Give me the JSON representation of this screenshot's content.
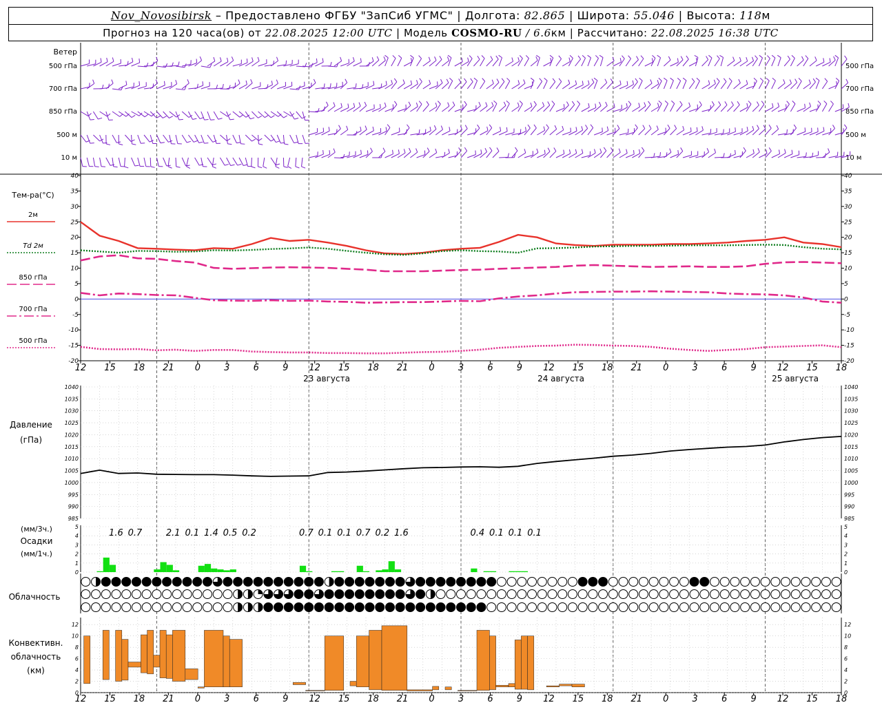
{
  "header": {
    "station": "Nov_Novosibirsk",
    "sep1": " – ",
    "provider": "Предоставлено ФГБУ \"ЗапСиб УГМС\"",
    "lon_label": "Долгота:",
    "lon_value": "82.865",
    "lat_label": "Широта:",
    "lat_value": "55.046",
    "alt_label": "Высота:",
    "alt_value": "118",
    "alt_unit": "м",
    "forecast_prefix": "Прогноз на 120 часа(ов) от",
    "forecast_time": "22.08.2025 12:00 UTC",
    "model_label": "Модель",
    "model_name": "COSMO-RU",
    "model_res": "6.6",
    "model_res_unit": "км",
    "calc_label": "Рассчитано:",
    "calc_time": "22.08.2025 16:38 UTC"
  },
  "chart_data": [
    {
      "type": "wind_barbs",
      "title": "Ветер",
      "levels": [
        "500 гПа",
        "700 гПа",
        "850 гПа",
        "500 м",
        "10 м"
      ],
      "color": "#7b20c8"
    },
    {
      "type": "line",
      "title": "Тем-ра(°С)",
      "ylim": [
        -20,
        40
      ],
      "yticks": [
        -20,
        -15,
        -10,
        -5,
        0,
        5,
        10,
        15,
        20,
        25,
        30,
        35,
        40
      ],
      "x_hours_since_start": [
        0,
        3,
        6,
        9,
        12,
        15,
        18,
        21,
        24,
        27,
        30,
        33,
        36,
        39,
        42,
        45,
        48,
        51,
        54,
        57,
        60,
        63,
        66,
        69,
        72,
        75,
        78,
        81,
        84,
        87,
        90,
        93,
        96,
        99,
        102,
        105,
        108,
        111,
        114,
        117,
        120
      ],
      "series": [
        {
          "name": "2м",
          "color": "#e8322b",
          "dash": "solid",
          "values": [
            25,
            20.5,
            18.8,
            16.5,
            16.3,
            16,
            15.8,
            16.5,
            16.3,
            17.8,
            19.8,
            18.8,
            19.2,
            18.3,
            17.2,
            15.8,
            14.8,
            14.6,
            15,
            15.8,
            16.3,
            16.6,
            18.5,
            20.8,
            20,
            18,
            17.5,
            17.2,
            17.6,
            17.6,
            17.6,
            17.8,
            17.8,
            18,
            18.3,
            18.8,
            19.2,
            20,
            18.3,
            17.8,
            16.8
          ]
        },
        {
          "name": "Td  2м",
          "color": "#0c7c1c",
          "dash": "dotted",
          "values": [
            15.8,
            15.4,
            15,
            15.6,
            15.5,
            15.3,
            15.4,
            15.8,
            15.7,
            15.9,
            16.2,
            16.4,
            16.7,
            16.3,
            15.6,
            15,
            14.5,
            14.3,
            14.8,
            15.5,
            15.8,
            15.5,
            15.4,
            15,
            16.4,
            16.5,
            16.7,
            17,
            17.1,
            17.2,
            17.2,
            17.3,
            17.4,
            17.4,
            17.4,
            17.5,
            17.6,
            17.5,
            16.8,
            16.3,
            16.1
          ]
        },
        {
          "name": "850 гПа",
          "color": "#e0288a",
          "dash": "longdash",
          "values": [
            12.5,
            13.8,
            14.2,
            13.2,
            13,
            12.3,
            11.8,
            10.1,
            9.8,
            10,
            10.2,
            10.3,
            10.2,
            10.1,
            9.8,
            9.5,
            9,
            9,
            9,
            9.2,
            9.4,
            9.5,
            9.8,
            10,
            10.2,
            10.4,
            10.8,
            11,
            10.8,
            10.6,
            10.4,
            10.5,
            10.6,
            10.4,
            10.4,
            10.6,
            11.4,
            11.9,
            12,
            11.8,
            11.6
          ]
        },
        {
          "name": "700 гПа",
          "color": "#e0288a",
          "dash": "dashdot",
          "values": [
            2,
            1.2,
            1.8,
            1.6,
            1.3,
            1.2,
            0.4,
            -0.4,
            -0.5,
            -0.6,
            -0.4,
            -0.6,
            -0.5,
            -0.8,
            -0.9,
            -1.2,
            -1.1,
            -1,
            -1,
            -0.8,
            -0.6,
            -0.7,
            0.2,
            0.8,
            1.2,
            1.8,
            2.2,
            2.3,
            2.4,
            2.4,
            2.5,
            2.4,
            2.3,
            2.2,
            1.8,
            1.6,
            1.5,
            1.2,
            0.5,
            -0.8,
            -1.2
          ]
        },
        {
          "name": "500 гПа",
          "color": "#e0288a",
          "dash": "dotted",
          "values": [
            -15.5,
            -16.2,
            -16.3,
            -16.2,
            -16.6,
            -16.4,
            -16.8,
            -16.5,
            -16.5,
            -17,
            -17.2,
            -17.3,
            -17.3,
            -17.5,
            -17.5,
            -17.6,
            -17.6,
            -17.4,
            -17.2,
            -17.1,
            -16.8,
            -16.4,
            -15.8,
            -15.5,
            -15.2,
            -15.1,
            -14.8,
            -14.9,
            -15.1,
            -15.2,
            -15.5,
            -16.1,
            -16.5,
            -16.8,
            -16.5,
            -16.2,
            -15.6,
            -15.4,
            -15.2,
            -15,
            -15.6
          ]
        }
      ]
    },
    {
      "type": "line",
      "title": "Давление",
      "units": "(гПа)",
      "ylim": [
        985,
        1040
      ],
      "yticks": [
        985,
        990,
        995,
        1000,
        1005,
        1010,
        1015,
        1020,
        1025,
        1030,
        1035,
        1040
      ],
      "x_hours_since_start": [
        0,
        3,
        6,
        9,
        12,
        15,
        18,
        21,
        24,
        27,
        30,
        33,
        36,
        39,
        42,
        45,
        48,
        51,
        54,
        57,
        60,
        63,
        66,
        69,
        72,
        75,
        78,
        81,
        84,
        87,
        90,
        93,
        96,
        99,
        102,
        105,
        108,
        111,
        114,
        117,
        120
      ],
      "series": [
        {
          "name": "",
          "color": "#000000",
          "values": [
            1003.8,
            1005.2,
            1003.8,
            1004,
            1003.5,
            1003.4,
            1003.3,
            1003.3,
            1003.1,
            1002.8,
            1002.6,
            1002.7,
            1002.8,
            1004.2,
            1004.4,
            1004.8,
            1005.3,
            1005.8,
            1006.2,
            1006.3,
            1006.5,
            1006.6,
            1006.4,
            1006.8,
            1008,
            1008.8,
            1009.5,
            1010.2,
            1011,
            1011.5,
            1012.2,
            1013.2,
            1013.8,
            1014.3,
            1014.8,
            1015.1,
            1015.7,
            1017,
            1018,
            1018.8,
            1019.3
          ]
        }
      ]
    },
    {
      "type": "bar",
      "title": "Осадки",
      "units_top": "(мм/3ч.)",
      "units_bottom": "(мм/1ч.)",
      "ylim": [
        0,
        5
      ],
      "yticks": [
        0,
        1,
        2,
        3,
        4,
        5
      ],
      "color": "#12e012",
      "totals_3h": [
        {
          "h": 4.5,
          "label": "1.6"
        },
        {
          "h": 7.5,
          "label": "0.7"
        },
        {
          "h": 13.5,
          "label": "2.1"
        },
        {
          "h": 16.5,
          "label": "0.1"
        },
        {
          "h": 19.5,
          "label": "1.4"
        },
        {
          "h": 22.5,
          "label": "0.5"
        },
        {
          "h": 25.5,
          "label": "0.2"
        },
        {
          "h": 34.5,
          "label": "0.7"
        },
        {
          "h": 37.5,
          "label": "0.1"
        },
        {
          "h": 40.5,
          "label": "0.1"
        },
        {
          "h": 43.5,
          "label": "0.7"
        },
        {
          "h": 46.5,
          "label": "0.2"
        },
        {
          "h": 49.5,
          "label": "1.6"
        },
        {
          "h": 61.5,
          "label": "0.4"
        },
        {
          "h": 64.5,
          "label": "0.1"
        },
        {
          "h": 67.5,
          "label": "0.1"
        },
        {
          "h": 70.5,
          "label": "0.1"
        }
      ],
      "hourly": [
        0,
        0,
        0,
        0.1,
        0,
        0,
        1.6,
        0.8,
        0,
        0,
        0,
        0,
        0,
        0,
        0.3,
        1.1,
        0.8,
        0.2,
        0,
        0,
        0.7,
        0.9,
        0.4,
        0.3,
        0.2,
        0,
        0.3,
        0,
        0,
        0,
        0,
        0,
        0,
        0,
        0,
        0,
        0,
        0,
        0,
        0,
        0,
        0,
        0,
        0,
        0,
        0,
        0,
        0,
        0,
        0,
        0,
        0,
        0,
        0,
        0,
        0,
        0,
        0,
        0,
        0,
        0,
        0,
        0,
        0,
        0,
        0,
        0,
        0,
        0,
        0,
        0,
        0,
        0,
        0,
        0,
        0,
        0,
        0,
        0,
        0,
        0,
        0,
        0,
        0,
        0,
        0,
        0,
        0,
        0,
        0,
        0,
        0,
        0,
        0,
        0,
        0,
        0,
        0,
        0,
        0,
        0,
        0,
        0,
        0,
        0,
        0,
        0,
        0,
        0,
        0,
        0,
        0,
        0,
        0,
        0,
        0,
        0,
        0,
        0,
        0,
        0,
        0,
        0,
        0,
        0,
        0,
        0,
        0,
        0,
        0,
        0,
        0,
        0,
        0,
        0,
        0,
        0,
        0,
        0,
        0,
        0,
        0,
        0,
        0,
        0,
        0,
        0,
        0,
        0,
        0,
        0,
        0,
        0,
        0,
        0,
        0,
        0,
        0,
        0,
        0,
        0,
        0,
        0,
        0,
        0,
        0,
        0,
        0,
        0,
        0,
        0,
        0,
        0,
        0
      ],
      "hourly_sparse": [
        {
          "h": 3,
          "v": 0.1
        },
        {
          "h": 4,
          "v": 1.6
        },
        {
          "h": 5,
          "v": 0.8
        },
        {
          "h": 12,
          "v": 0.3
        },
        {
          "h": 13,
          "v": 1.1
        },
        {
          "h": 14,
          "v": 0.8
        },
        {
          "h": 15,
          "v": 0.2
        },
        {
          "h": 19,
          "v": 0.7
        },
        {
          "h": 20,
          "v": 0.9
        },
        {
          "h": 21,
          "v": 0.4
        },
        {
          "h": 22,
          "v": 0.3
        },
        {
          "h": 23,
          "v": 0.2
        },
        {
          "h": 24,
          "v": 0.3
        },
        {
          "h": 35,
          "v": 0.7
        },
        {
          "h": 36,
          "v": 0.1
        },
        {
          "h": 40,
          "v": 0.1
        },
        {
          "h": 41,
          "v": 0.1
        },
        {
          "h": 44,
          "v": 0.7
        },
        {
          "h": 45,
          "v": 0.1
        },
        {
          "h": 47,
          "v": 0.2
        },
        {
          "h": 48,
          "v": 0.3
        },
        {
          "h": 49,
          "v": 1.2
        },
        {
          "h": 50,
          "v": 0.3
        },
        {
          "h": 62,
          "v": 0.4
        },
        {
          "h": 64,
          "v": 0.1
        },
        {
          "h": 65,
          "v": 0.1
        },
        {
          "h": 68,
          "v": 0.1
        },
        {
          "h": 69,
          "v": 0.1
        },
        {
          "h": 70,
          "v": 0.1
        }
      ]
    },
    {
      "type": "cloud_symbols",
      "title": "Облачность",
      "rows": [
        "0123444444444444444444444444433444444444444444444444444424444442444444444433444444444444444444400000000000000000004444444400000000000000000003444440000000000000000000000000000000",
        "0000000000000000000000000000000000022222213333443444443344444444444444444444333422200000000000000000000000000000000000000000000000000000000000000000000000000000000000000000000000000",
        "0000000000000000000000000000000000002222224444444444444444444444444444444444444444444444444444440000000000000000000000000000000000000000000000000000000000000000000000000000000000000"
      ]
    },
    {
      "type": "bar",
      "title": "Конвективн. облачность",
      "units": "(км)",
      "ylim": [
        0,
        13
      ],
      "yticks": [
        0,
        2,
        4,
        6,
        8,
        10,
        12
      ],
      "color": "#f08a28",
      "bars": [
        {
          "h0": 0.5,
          "h1": 1.5,
          "base": 1.6,
          "top": 10
        },
        {
          "h0": 3.5,
          "h1": 4.5,
          "base": 2.3,
          "top": 11
        },
        {
          "h0": 5.5,
          "h1": 6.5,
          "base": 2.0,
          "top": 11
        },
        {
          "h0": 6.5,
          "h1": 7.5,
          "base": 2.2,
          "top": 9.4
        },
        {
          "h0": 7.5,
          "h1": 9.5,
          "base": 4.5,
          "top": 5.4
        },
        {
          "h0": 9.5,
          "h1": 10.5,
          "base": 3.5,
          "top": 10.2
        },
        {
          "h0": 10.5,
          "h1": 11.5,
          "base": 3.3,
          "top": 11
        },
        {
          "h0": 11.5,
          "h1": 12.5,
          "base": 4.5,
          "top": 6.6
        },
        {
          "h0": 12.5,
          "h1": 13.5,
          "base": 2.6,
          "top": 11
        },
        {
          "h0": 13.5,
          "h1": 14.5,
          "base": 2.5,
          "top": 10.2
        },
        {
          "h0": 14.5,
          "h1": 16.5,
          "base": 2.0,
          "top": 11
        },
        {
          "h0": 16.5,
          "h1": 18.5,
          "base": 2.3,
          "top": 4.2
        },
        {
          "h0": 18.5,
          "h1": 19.5,
          "base": 0.8,
          "top": 1.0
        },
        {
          "h0": 19.5,
          "h1": 22.5,
          "base": 1.0,
          "top": 11
        },
        {
          "h0": 22.5,
          "h1": 23.5,
          "base": 1.0,
          "top": 10
        },
        {
          "h0": 23.5,
          "h1": 25.5,
          "base": 1.0,
          "top": 9.4
        },
        {
          "h0": 33.5,
          "h1": 35.5,
          "base": 1.4,
          "top": 1.8
        },
        {
          "h0": 35.5,
          "h1": 38.5,
          "base": 0.3,
          "top": 0.4
        },
        {
          "h0": 38.5,
          "h1": 41.5,
          "base": 0.4,
          "top": 10
        },
        {
          "h0": 42.5,
          "h1": 43.5,
          "base": 1.2,
          "top": 2
        },
        {
          "h0": 43.5,
          "h1": 45.5,
          "base": 1.0,
          "top": 10
        },
        {
          "h0": 45.5,
          "h1": 47.5,
          "base": 0.5,
          "top": 11
        },
        {
          "h0": 47.5,
          "h1": 51.5,
          "base": 0.4,
          "top": 11.8
        },
        {
          "h0": 51.5,
          "h1": 55.5,
          "base": 0.3,
          "top": 0.5
        },
        {
          "h0": 55.5,
          "h1": 56.5,
          "base": 0.5,
          "top": 1.1
        },
        {
          "h0": 57.5,
          "h1": 58.5,
          "base": 0.5,
          "top": 1.0
        },
        {
          "h0": 59.5,
          "h1": 62.5,
          "base": 0.3,
          "top": 0.4
        },
        {
          "h0": 62.5,
          "h1": 64.5,
          "base": 0.4,
          "top": 11
        },
        {
          "h0": 64.5,
          "h1": 65.5,
          "base": 0.5,
          "top": 10
        },
        {
          "h0": 65.5,
          "h1": 67.5,
          "base": 1.0,
          "top": 1.3
        },
        {
          "h0": 67.5,
          "h1": 68.5,
          "base": 1.0,
          "top": 1.6
        },
        {
          "h0": 68.5,
          "h1": 69.5,
          "base": 0.6,
          "top": 9.3
        },
        {
          "h0": 69.5,
          "h1": 70.5,
          "base": 0.6,
          "top": 10
        },
        {
          "h0": 70.5,
          "h1": 71.5,
          "base": 0.5,
          "top": 10
        },
        {
          "h0": 73.5,
          "h1": 75.5,
          "base": 1.0,
          "top": 1.2
        },
        {
          "h0": 75.5,
          "h1": 77.5,
          "base": 1.2,
          "top": 1.5
        },
        {
          "h0": 77.5,
          "h1": 79.5,
          "base": 1.0,
          "top": 1.5
        }
      ]
    }
  ],
  "time_axis": {
    "start_hour": 12,
    "step_hours": 3,
    "tick_labels": [
      "12",
      "15",
      "18",
      "21",
      "0",
      "3",
      "6",
      "9",
      "12",
      "15",
      "18",
      "21",
      "0",
      "3",
      "6",
      "9",
      "12",
      "15",
      "18",
      "21",
      "0",
      "3",
      "6",
      "9",
      "12",
      "15",
      "18"
    ],
    "day_labels": [
      "23 августа",
      "24 августа",
      "25 августа"
    ]
  }
}
